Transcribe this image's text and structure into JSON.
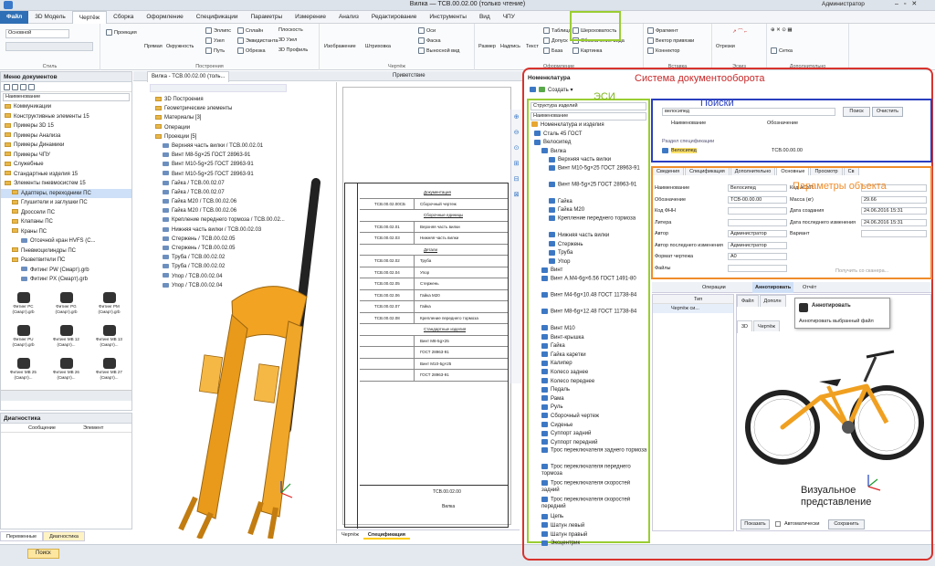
{
  "window": {
    "title": "Вилка — ТСВ.00.02.00 (только чтение)",
    "user": "Администратор"
  },
  "menu": [
    "Файл",
    "3D Модель",
    "Чертёж",
    "Сборка",
    "Оформление",
    "Спецификации",
    "Параметры",
    "Измерение",
    "Анализ",
    "Редактирование",
    "Инструменты",
    "Вид",
    "ЧПУ"
  ],
  "ribbon": {
    "style_label": "Основной",
    "groups": [
      "Стиль",
      "Построения",
      "Чертёж",
      "Оформление",
      "Вставка",
      "Эскиз",
      "Дополнительно"
    ],
    "tools": {
      "projection": "Проекция",
      "line": "Прямая",
      "circle": "Окружность",
      "ellipse": "Эллипс",
      "node": "Узел",
      "path": "Путь",
      "spline": "Сплайн",
      "equidistant": "Эквидистанта",
      "trim": "Обрезка",
      "plane": "Плоскость",
      "node3d": "3D Узел",
      "profile3d": "3D Профиль",
      "image": "Изображение",
      "hatch": "Штриховка",
      "axes": "Оси",
      "chamfer": "Фаска",
      "leader": "Выносной вид",
      "size": "Размер",
      "label": "Надпись",
      "text": "Текст",
      "table": "Таблица",
      "tolerance": "Допуск",
      "base": "База",
      "roughness": "Шероховатость",
      "view_note": "Обозначение вида",
      "picture": "Картинка",
      "fragment": "Фрагмент",
      "vector": "Вектор привязки",
      "connector": "Коннектор",
      "sections": "Отрезки",
      "grid": "Сетка"
    }
  },
  "docs_menu": {
    "title": "Меню документов",
    "header": "Наименование",
    "items": [
      "Коммуникации",
      "Конструктивные элементы 15",
      "Примеры 3D 15",
      "Примеры Анализа",
      "Примеры Динамики",
      "Примеры ЧПУ",
      "Служебные",
      "Стандартные изделия 15",
      "Элементы пневмосистем 15",
      "Адаптеры, переходники ПС",
      "Глушители и заглушки ПС",
      "Дроссели ПС",
      "Клапаны ПС",
      "Краны ПС",
      "Отсечной кран HVFS (С...",
      "Пневмоцилиндры ПС",
      "Разветвители ПС",
      "Фитинг PW (Смарт).grb",
      "Фитинг PX (Смарт).grb"
    ]
  },
  "fittings": [
    "Фитинг PC (Смарт).grb",
    "Фитинг PG (Смарт).grb",
    "Фитинг PM (Смарт).grb",
    "Фитинг PU (Смарт).grb",
    "Фитинг MB 12 (Смарт)...",
    "Фитинг MB 13 (Смарт)...",
    "Фитинг MB 25 (Смарт)...",
    "Фитинг MB 26 (Смарт)...",
    "Фитинг MB 27 (Смарт)..."
  ],
  "diagnostics": {
    "title": "Диагностика",
    "col1": "Сообщение",
    "col2": "Элемент"
  },
  "bottom_tabs": {
    "vars": "Переменные",
    "diag": "Диагностика",
    "search": "Поиск"
  },
  "doc_tab": {
    "name": "Вилка - ТСВ.00.02.00 (толь...",
    "other": "Приветствие"
  },
  "model_tree": [
    "3D Построения",
    "Геометрические элементы",
    "Материалы [3]",
    "Операции",
    "Проекции [5]",
    "Верхняя часть вилки / ТСВ.00.02.01",
    "Винт М8-5g×25 ГОСТ 28963-91",
    "Винт М10-5g×25 ГОСТ 28963-91",
    "Винт М10-5g×25 ГОСТ 28963-91",
    "Гайка / ТСВ.00.02.07",
    "Гайка / ТСВ.00.02.07",
    "Гайка М20 / ТСВ.00.02.06",
    "Гайка М20 / ТСВ.00.02.06",
    "Крепление переднего тормоза / ТСВ.00.02...",
    "Нижняя часть вилки / ТСВ.00.02.03",
    "Стержень / ТСВ.00.02.05",
    "Стержень / ТСВ.00.02.05",
    "Труба / ТСВ.00.02.02",
    "Труба / ТСВ.00.02.02",
    "Упор / ТСВ.00.02.04",
    "Упор / ТСВ.00.02.04"
  ],
  "drawing": {
    "code": "ТСВ.00.02.00",
    "name": "Вилка",
    "sections": [
      "Документация",
      "Сборочные единицы",
      "Детали",
      "Стандартные изделия"
    ],
    "rows": [
      [
        "ТСВ.00.02.00СБ",
        "Сборочный чертеж"
      ],
      [
        "ТСВ.00.02.01",
        "Верхняя часть вилки"
      ],
      [
        "ТСВ.00.02.03",
        "Нижняя часть вилки"
      ],
      [
        "ТСВ.00.02.02",
        "Труба"
      ],
      [
        "ТСВ.00.02.04",
        "Упор"
      ],
      [
        "ТСВ.00.02.05",
        "Стержень"
      ],
      [
        "ТСВ.00.02.06",
        "Гайка М20"
      ],
      [
        "ТСВ.00.02.07",
        "Гайка"
      ],
      [
        "ТСВ.00.02.08",
        "Крепление переднего тормоза"
      ],
      [
        "",
        "Винт М8-5g×25"
      ],
      [
        "",
        "ГОСТ 28963-91"
      ],
      [
        "",
        "Винт М10-5g×25"
      ],
      [
        "",
        "ГОСТ 28963-91"
      ]
    ],
    "tabs": [
      "Чертёж",
      "Спецификация"
    ]
  },
  "annotations": {
    "system": "Система документооборота",
    "esi": "ЭСИ",
    "search": "Поиски",
    "params": "Параметры объекта",
    "visual": "Визуальное\nпредставление"
  },
  "nomenclature": {
    "title": "Номенклатура",
    "create": "Создать",
    "structure": "Структура изделий",
    "col": "Наименование",
    "root": "Номенклатура и изделия",
    "items": [
      [
        "Сталь 45 ГОСТ",
        0
      ],
      [
        "Велосипед",
        0
      ],
      [
        "Вилка",
        1
      ],
      [
        "Верхняя часть вилки",
        2
      ],
      [
        "Винт М10-5g×25 ГОСТ 28963-91",
        2
      ],
      [
        "Винт М8-5g×25 ГОСТ 28963-91",
        2
      ],
      [
        "Гайка",
        2
      ],
      [
        "Гайка М20",
        2
      ],
      [
        "Крепление переднего тормоза",
        2
      ],
      [
        "Нижняя часть вилки",
        2
      ],
      [
        "Стержень",
        2
      ],
      [
        "Труба",
        2
      ],
      [
        "Упор",
        2
      ],
      [
        "Винт",
        1
      ],
      [
        "Винт А.М4-6g×6.56 ГОСТ 1491-80",
        1
      ],
      [
        "Винт М4-6g×10.48 ГОСТ 11738-84",
        1
      ],
      [
        "Винт М8-6g×12.48 ГОСТ 11738-84",
        1
      ],
      [
        "Винт М10",
        1
      ],
      [
        "Винт-крышка",
        1
      ],
      [
        "Гайка",
        1
      ],
      [
        "Гайка каретки",
        1
      ],
      [
        "Калипер",
        1
      ],
      [
        "Колесо заднее",
        1
      ],
      [
        "Колесо переднее",
        1
      ],
      [
        "Педаль",
        1
      ],
      [
        "Рама",
        1
      ],
      [
        "Руль",
        1
      ],
      [
        "Сборочный чертеж",
        1
      ],
      [
        "Сиденье",
        1
      ],
      [
        "Суппорт задний",
        1
      ],
      [
        "Суппорт передний",
        1
      ],
      [
        "Трос переключателя заднего тормоза",
        1
      ],
      [
        "Трос переключателя переднего тормоза",
        1
      ],
      [
        "Трос переключателя скоростей задний",
        1
      ],
      [
        "Трос переключателя скоростей передний",
        1
      ],
      [
        "Цепь",
        1
      ],
      [
        "Шатун левый",
        1
      ],
      [
        "Шатун правый",
        1
      ],
      [
        "Эксцентрик",
        1
      ]
    ]
  },
  "search": {
    "value": "велосипед",
    "col": "Наименование",
    "col2": "Обозначение",
    "btn_search": "Поиск",
    "btn_clear": "Очистить",
    "section": "Раздел спецификации",
    "result_name": "Велосипед",
    "result_code": "ТСВ.00.00.00"
  },
  "props": {
    "tabs": [
      "Сведения",
      "Спецификация",
      "Дополнительно",
      "Основные",
      "Просмотр",
      "Св"
    ],
    "fields": [
      [
        "Наименование",
        "Велосипед"
      ],
      [
        "Обозначение",
        "ТСВ-00.00.00"
      ],
      [
        "Код ФНН",
        ""
      ],
      [
        "Литера",
        ""
      ],
      [
        "Автор",
        "Администратор"
      ],
      [
        "Автор последнего изменения",
        "Администратор"
      ],
      [
        "Формат чертежа",
        "А0"
      ],
      [
        "Файлы",
        ""
      ]
    ],
    "right": [
      [
        "Код АСУП",
        ""
      ],
      [
        "Масса (кг)",
        "29.66"
      ],
      [
        "Дата создания",
        "24.06.2016 15:31"
      ],
      [
        "Дата последнего изменения",
        "24.06.2016 15:31"
      ],
      [
        "Вариант",
        ""
      ]
    ],
    "files_link": "Получить со сканера..."
  },
  "ops": {
    "operations": "Операции",
    "annotate": "Аннотировать",
    "report": "Отчёт",
    "file_tab": "Файл",
    "extra_tab": "Дополн",
    "col_type": "Тип",
    "row": "Чертёж си...",
    "popup_title": "Аннотировать",
    "popup_desc": "Аннотировать выбранный файл"
  },
  "viewer": {
    "tabs": [
      "3D",
      "Чертёж"
    ],
    "show": "Показать",
    "auto": "Автоматически",
    "save": "Сохранить"
  }
}
